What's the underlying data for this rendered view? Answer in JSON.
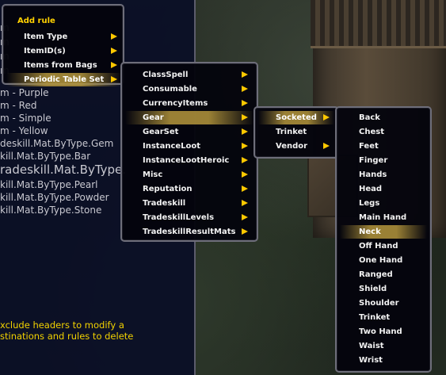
{
  "panel_lines": [
    "m - Purple",
    "m - Red",
    "m - Simple",
    "m - Yellow",
    "deskill.Mat.ByType.Gem",
    "kill.Mat.ByType.Bar",
    "radeskill.Mat.ByType.",
    "kill.Mat.ByType.Pearl",
    "kill.Mat.ByType.Powder",
    "kill.Mat.ByType.Stone"
  ],
  "panel_partial": [
    "m",
    "m",
    "m",
    "m"
  ],
  "footer_lines": [
    "xclude headers to modify a",
    "stinations and rules to delete"
  ],
  "menu1": {
    "title": "Add rule",
    "items": [
      "Item Type",
      "ItemID(s)",
      "Items from Bags",
      "Periodic Table Set"
    ]
  },
  "menu2": {
    "items": [
      "ClassSpell",
      "Consumable",
      "CurrencyItems",
      "Gear",
      "GearSet",
      "InstanceLoot",
      "InstanceLootHeroic",
      "Misc",
      "Reputation",
      "Tradeskill",
      "TradeskillLevels",
      "TradeskillResultMats"
    ]
  },
  "menu3": {
    "items": [
      "Socketed",
      "Trinket",
      "Vendor"
    ]
  },
  "menu4": {
    "items": [
      "Back",
      "Chest",
      "Feet",
      "Finger",
      "Hands",
      "Head",
      "Legs",
      "Main Hand",
      "Neck",
      "Off Hand",
      "One Hand",
      "Ranged",
      "Shield",
      "Shoulder",
      "Trinket",
      "Two Hand",
      "Waist",
      "Wrist"
    ]
  },
  "colors": {
    "accent": "#ffd100",
    "arrow": "#ffc800",
    "footer": "#f2d200"
  }
}
